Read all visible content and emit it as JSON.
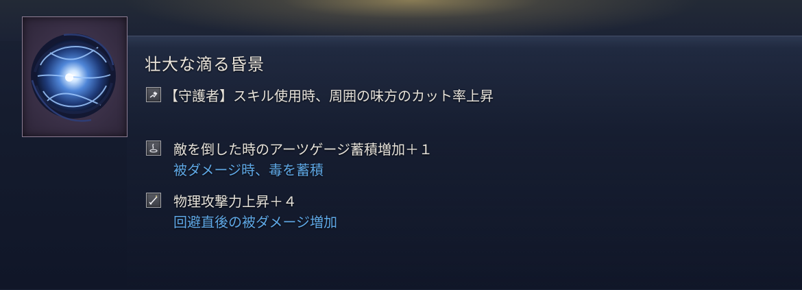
{
  "item": {
    "name": "壮大な滴る昏景",
    "image_icon": "dark-blue-orb-relic-icon"
  },
  "effects": [
    {
      "icon": "guardian-skill-icon",
      "text": "【守護者】スキル使用時、周囲の味方のカット率上昇",
      "drawback": ""
    },
    {
      "icon": "arts-gauge-icon",
      "text": "敵を倒した時のアーツゲージ蓄積増加＋１",
      "drawback": "被ダメージ時、毒を蓄積"
    },
    {
      "icon": "sword-attack-icon",
      "text": "物理攻撃力上昇＋４",
      "drawback": "回避直後の被ダメージ増加"
    }
  ],
  "colors": {
    "background": "#151c2e",
    "title": "#ece6dc",
    "effect_text": "#e6e2da",
    "drawback_text": "#5fa8e6",
    "frame_border": "#8f7f96"
  }
}
